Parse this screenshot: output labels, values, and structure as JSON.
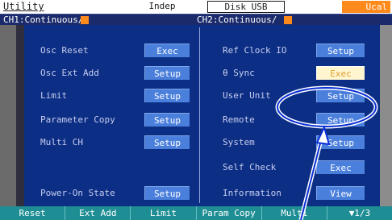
{
  "header": {
    "title": "Utility",
    "mode": "Indep",
    "storage": "Disk USB",
    "status_badge": "Ucal"
  },
  "channels": {
    "ch1": "CH1:Continuous/",
    "ch2": "CH2:Continuous/"
  },
  "menu": {
    "left": [
      {
        "label": "Osc Reset",
        "button": "Exec"
      },
      {
        "label": "Osc Ext Add",
        "button": "Setup"
      },
      {
        "label": "Limit",
        "button": "Setup"
      },
      {
        "label": "Parameter Copy",
        "button": "Setup"
      },
      {
        "label": "Multi CH",
        "button": "Setup"
      },
      {
        "label": "Power-On State",
        "button": "Setup"
      }
    ],
    "right": [
      {
        "label": "Ref Clock IO",
        "button": "Setup"
      },
      {
        "label": "θ Sync",
        "button": "Exec"
      },
      {
        "label": "User Unit",
        "button": "Setup"
      },
      {
        "label": "Remote",
        "button": "Setup"
      },
      {
        "label": "System",
        "button": "Setup"
      },
      {
        "label": "Self Check",
        "button": "Exec"
      },
      {
        "label": "Information",
        "button": "View"
      }
    ]
  },
  "softkeys": [
    "Reset",
    "Ext Add",
    "Limit",
    "Param Copy",
    "Multi",
    "▼1/3"
  ],
  "colors": {
    "panel": "#0c2f85",
    "button": "#4a7fdc",
    "softkey_bar": "#1f8e94",
    "accent_orange": "#ff8a1c",
    "annotation": "#0a2fd6"
  }
}
